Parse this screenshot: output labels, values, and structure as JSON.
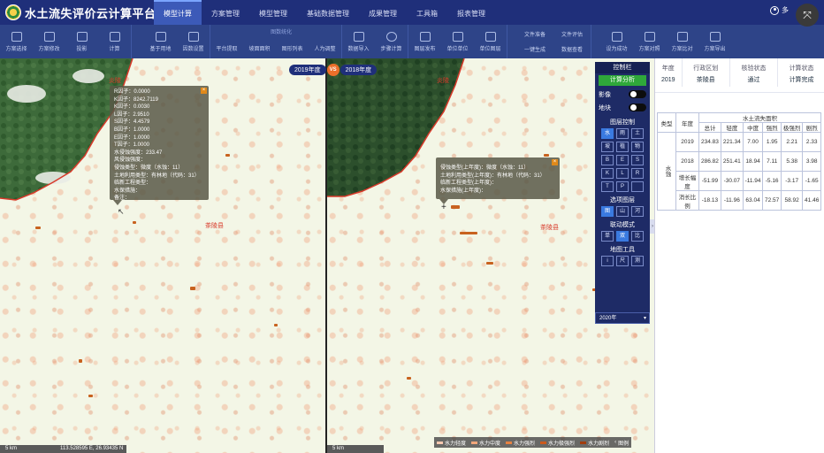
{
  "header": {
    "title": "水土流失评价云计算平台",
    "user": "多"
  },
  "menu": [
    "模型计算",
    "方案管理",
    "模型管理",
    "基础数据管理",
    "成果管理",
    "工具箱",
    "报表管理"
  ],
  "toolbar": {
    "group1": [
      "方案选择",
      "方案修改",
      "投影",
      "计算"
    ],
    "group2_label": "",
    "group2": [
      "基于用地",
      "因数设置"
    ],
    "group3_label": "图数统化",
    "group3": [
      "平台提取",
      "坡面面积",
      "图形列表",
      "人为调整"
    ],
    "group4": [
      "数据导入",
      "步骤计算"
    ],
    "group5": [
      "图层发布",
      "单位单位",
      "单位图层"
    ],
    "group6_top": "文件准备",
    "group6_bottom": "一键生成",
    "group7_top": "文件评估",
    "group7_bottom": "数据查看",
    "group8": [
      "设为成功",
      "方案对照",
      "方案比对",
      "方案导出"
    ]
  },
  "compare": {
    "left_year": "2019年度",
    "vs": "VS",
    "right_year": "2018年度"
  },
  "map_left": {
    "county": "茶陵县",
    "north_label": "炎陵",
    "scale": "5 km",
    "coords": "113.528595 E, 26.93435 N",
    "popup": [
      "R因子：0.0000",
      "K因子：8242.7119",
      "K因子：0.0030",
      "L因子：2.9510",
      "S因子：4.4579",
      "B因子：1.0000",
      "E因子：1.0000",
      "T因子：1.0000",
      "水侵蚀强度：233.47",
      "风侵蚀强度：",
      "侵蚀类型：微度（水蚀：11）",
      "土地利用类型：有林地（代码：31）",
      "临新工程类型：",
      "水保措施：",
      "备注："
    ]
  },
  "map_right": {
    "county": "茶陵县",
    "north_label": "炎陵",
    "scale": "5 km",
    "popup": [
      "侵蚀类型(上年度)：微度（水蚀：11）",
      "土地利用类型(上年度)：有林地（代码：31）",
      "临新工程类型(上年度)：",
      "水保措施(上年度)："
    ]
  },
  "control": {
    "title": "控制栏",
    "calc": "计算分析",
    "image": "影像",
    "patch": "地块",
    "layer_control": "图层控制",
    "overlay": "选项图层",
    "sync_mode": "联动模式",
    "map_tools": "地图工具",
    "year_select": "2020年",
    "layer_icons": [
      "水",
      "雨",
      "土",
      "坡",
      "植",
      "物",
      "B",
      "E",
      "S",
      "K",
      "L",
      "R",
      "T",
      "P",
      ""
    ],
    "overlay_icons": [
      "图",
      "山",
      "河"
    ],
    "sync_icons": [
      "单",
      "双",
      "比"
    ],
    "tool_icons": [
      "i",
      "尺",
      "测"
    ]
  },
  "legend": [
    "水力轻度",
    "水力中度",
    "水力强烈",
    "水力极强烈",
    "水力剧烈"
  ],
  "legend_tail": "图例",
  "legend_colors": [
    "#f7c8b0",
    "#f2a77a",
    "#e68242",
    "#cc5a1c",
    "#a13d0c"
  ],
  "info": {
    "headers": [
      "年度",
      "行政区划",
      "核验状态",
      "计算状态"
    ],
    "values": [
      "2019",
      "茶陵县",
      "通过",
      "计算完成"
    ]
  },
  "table": {
    "col_type": "类型",
    "col_year": "年度",
    "group_title": "水土流失面积",
    "subs": [
      "总计",
      "轻度",
      "中度",
      "强烈",
      "极强烈",
      "剧烈"
    ],
    "side_label": "水蚀",
    "rows": [
      {
        "label": "2019",
        "vals": [
          "234.83",
          "221.34",
          "7.00",
          "1.95",
          "2.21",
          "2.33"
        ]
      },
      {
        "label": "2018",
        "vals": [
          "286.82",
          "251.41",
          "18.94",
          "7.11",
          "5.38",
          "3.98"
        ]
      },
      {
        "label": "增长幅度",
        "vals": [
          "-51.99",
          "-30.07",
          "-11.94",
          "-5.16",
          "-3.17",
          "-1.65"
        ]
      },
      {
        "label": "消长比例",
        "vals": [
          "-18.13",
          "-11.96",
          "63.04",
          "72.57",
          "58.92",
          "41.46"
        ]
      }
    ]
  }
}
